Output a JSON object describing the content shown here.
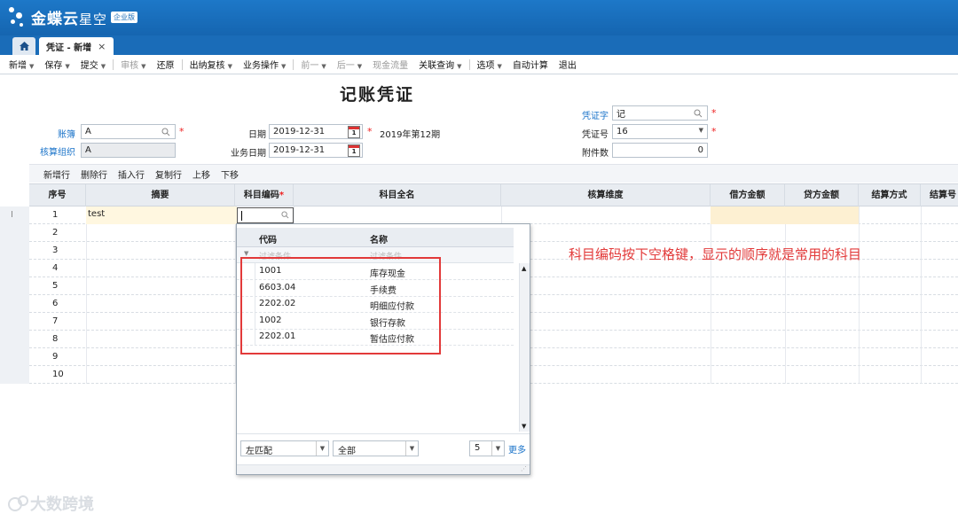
{
  "brand": {
    "name": "金蝶云",
    "sub": "星空",
    "edition": "企业版"
  },
  "tabs": {
    "doc_tab": "凭证 - 新增",
    "close": "×"
  },
  "toolbar": {
    "items": [
      {
        "label": "新增",
        "arrow": true,
        "disabled": false
      },
      {
        "label": "保存",
        "arrow": true,
        "disabled": false
      },
      {
        "label": "提交",
        "arrow": true,
        "disabled": false
      },
      {
        "label": "审核",
        "arrow": true,
        "disabled": true
      },
      {
        "label": "还原",
        "arrow": false,
        "disabled": false
      },
      {
        "label": "出纳复核",
        "arrow": true,
        "disabled": false
      },
      {
        "label": "业务操作",
        "arrow": true,
        "disabled": false
      },
      {
        "label": "前一",
        "arrow": true,
        "disabled": true
      },
      {
        "label": "后一",
        "arrow": true,
        "disabled": true
      },
      {
        "label": "现金流量",
        "arrow": false,
        "disabled": true
      },
      {
        "label": "关联查询",
        "arrow": true,
        "disabled": false
      },
      {
        "label": "选项",
        "arrow": true,
        "disabled": false
      },
      {
        "label": "自动计算",
        "arrow": false,
        "disabled": false
      },
      {
        "label": "退出",
        "arrow": false,
        "disabled": false
      }
    ]
  },
  "form": {
    "title": "记账凭证",
    "book_label": "账簿",
    "book_value": "A",
    "org_label": "核算组织",
    "org_value": "A",
    "date_label": "日期",
    "date_value": "2019-12-31",
    "period_text": "2019年第12期",
    "biz_date_label": "业务日期",
    "biz_date_value": "2019-12-31",
    "voucher_word_label": "凭证字",
    "voucher_word_value": "记",
    "voucher_no_label": "凭证号",
    "voucher_no_value": "16",
    "attach_label": "附件数",
    "attach_value": "0",
    "required": "*",
    "cal_day": "1"
  },
  "grid_toolbar": [
    "新增行",
    "删除行",
    "插入行",
    "复制行",
    "上移",
    "下移"
  ],
  "grid": {
    "columns": [
      "序号",
      "摘要",
      "科目编码",
      "科目全名",
      "核算维度",
      "借方金额",
      "贷方金额",
      "结算方式",
      "结算号"
    ],
    "row_marker": "I",
    "rows": [
      {
        "no": "1",
        "summary": "test"
      },
      {
        "no": "2",
        "summary": ""
      },
      {
        "no": "3",
        "summary": ""
      },
      {
        "no": "4",
        "summary": ""
      },
      {
        "no": "5",
        "summary": ""
      },
      {
        "no": "6",
        "summary": ""
      },
      {
        "no": "7",
        "summary": ""
      },
      {
        "no": "8",
        "summary": ""
      },
      {
        "no": "9",
        "summary": ""
      },
      {
        "no": "10",
        "summary": ""
      }
    ]
  },
  "lookup": {
    "col_code": "代码",
    "col_name": "名称",
    "filter_placeholder": "过滤条件",
    "items": [
      {
        "code": "1001",
        "name": "库存现金"
      },
      {
        "code": "6603.04",
        "name": "手续费"
      },
      {
        "code": "2202.02",
        "name": "明细应付款"
      },
      {
        "code": "1002",
        "name": "银行存款"
      },
      {
        "code": "2202.01",
        "name": "暂估应付款"
      }
    ],
    "match_mode": "左匹配",
    "scope": "全部",
    "page_size": "5",
    "more": "更多"
  },
  "annotation": "科目编码按下空格键，显示的顺序就是常用的科目",
  "watermark": "大数跨境",
  "colors": {
    "brand_blue": "#1a6cb8",
    "annotation_red": "#e23a3a",
    "link_blue": "#1a73c9"
  }
}
